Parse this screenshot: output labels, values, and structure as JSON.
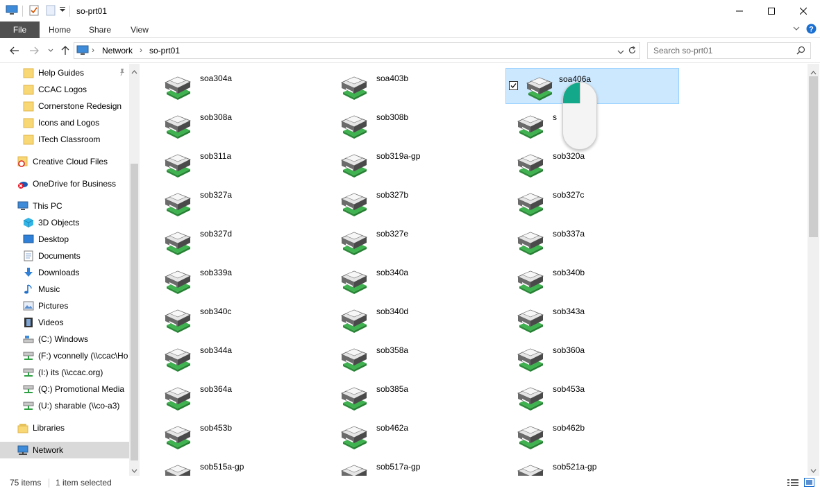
{
  "window": {
    "title": "so-prt01",
    "quick_access_icons": [
      "computer-icon",
      "properties-check-icon",
      "new-folder-icon",
      "customize-dropdown-icon"
    ],
    "controls": [
      "minimize-icon",
      "maximize-icon",
      "close-icon"
    ]
  },
  "ribbon": {
    "tabs": [
      "File",
      "Home",
      "Share",
      "View"
    ],
    "accent": "#505050",
    "help_color": "#1a6fd1"
  },
  "address": {
    "path": [
      "Network",
      "so-prt01"
    ],
    "search_placeholder": "Search so-prt01"
  },
  "nav": {
    "items": [
      {
        "label": "Help Guides",
        "icon": "folder-icon",
        "pinned": true
      },
      {
        "label": "CCAC Logos",
        "icon": "folder-icon"
      },
      {
        "label": "Cornerstone Redesign",
        "icon": "folder-icon"
      },
      {
        "label": "Icons and Logos",
        "icon": "folder-icon"
      },
      {
        "label": "ITech Classroom",
        "icon": "folder-icon"
      },
      {
        "label": "Creative Cloud Files",
        "icon": "creative-cloud-icon"
      },
      {
        "label": "OneDrive for Business",
        "icon": "onedrive-icon"
      },
      {
        "label": "This PC",
        "icon": "computer-icon"
      },
      {
        "label": "3D Objects",
        "icon": "cube-icon"
      },
      {
        "label": "Desktop",
        "icon": "desktop-icon"
      },
      {
        "label": "Documents",
        "icon": "documents-icon"
      },
      {
        "label": "Downloads",
        "icon": "download-arrow-icon"
      },
      {
        "label": "Music",
        "icon": "music-note-icon"
      },
      {
        "label": "Pictures",
        "icon": "pictures-icon"
      },
      {
        "label": "Videos",
        "icon": "film-icon"
      },
      {
        "label": "(C:) Windows",
        "icon": "drive-icon"
      },
      {
        "label": "(F:) vconnelly (\\\\ccac\\Ho",
        "icon": "network-drive-icon"
      },
      {
        "label": "(I:) its (\\\\ccac.org)",
        "icon": "network-drive-icon"
      },
      {
        "label": "(Q:) Promotional Media",
        "icon": "network-drive-icon"
      },
      {
        "label": "(U:) sharable (\\\\co-a3)",
        "icon": "network-drive-icon"
      },
      {
        "label": "Libraries",
        "icon": "libraries-icon"
      },
      {
        "label": "Network",
        "icon": "network-icon",
        "selected": true
      }
    ]
  },
  "printers": [
    "soa304a",
    "soa403b",
    "soa406a",
    "sob308a",
    "sob308b",
    "s",
    "sob311a",
    "sob319a-gp",
    "sob320a",
    "sob327a",
    "sob327b",
    "sob327c",
    "sob327d",
    "sob327e",
    "sob337a",
    "sob339a",
    "sob340a",
    "sob340b",
    "sob340c",
    "sob340d",
    "sob343a",
    "sob344a",
    "sob358a",
    "sob360a",
    "sob364a",
    "sob385a",
    "sob453a",
    "sob453b",
    "sob462a",
    "sob462b",
    "sob515a-gp",
    "sob517a-gp",
    "sob521a-gp"
  ],
  "selected_index": 2,
  "status": {
    "count": "75 items",
    "selection": "1 item selected"
  }
}
